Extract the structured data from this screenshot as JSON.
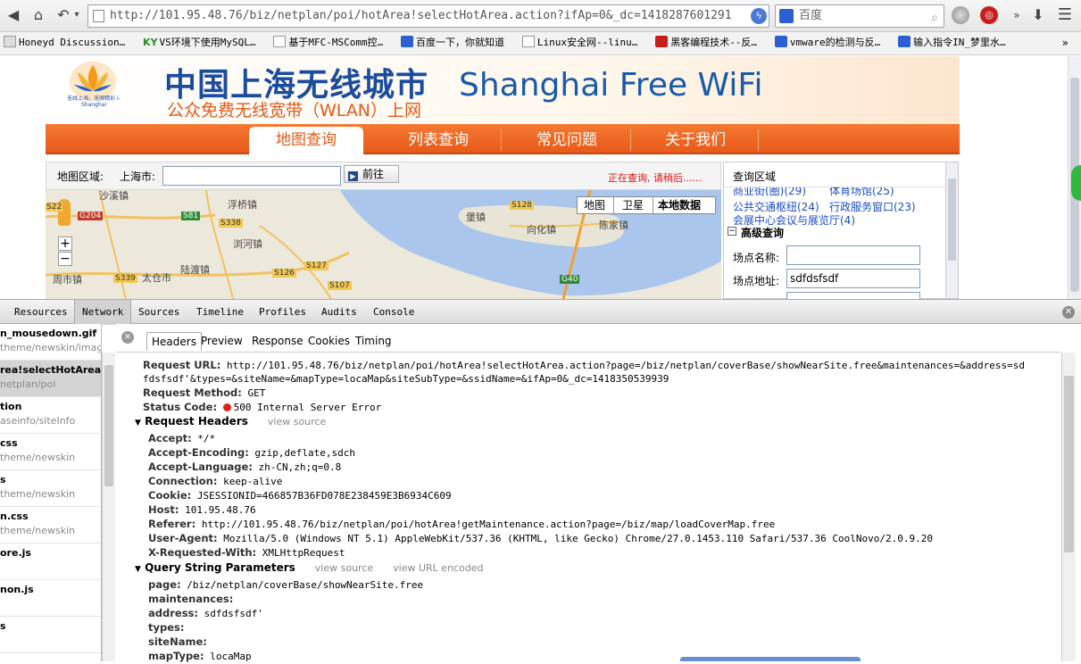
{
  "browser": {
    "url": "http://101.95.48.76/biz/netplan/poi/hotArea!selectHotArea.action?ifAp=0&_dc=1418287601291",
    "search_text": "百度",
    "bookmarks": [
      "Honeyd Discussion…",
      "VS环境下使用MySQL…",
      "基于MFC-MSComm控…",
      "百度一下，你就知道",
      "Linux安全网--linu…",
      "黑客编程技术--反…",
      "vmware的检测与反…",
      "输入指令IN_梦里水…"
    ],
    "bookmark_prefix": "KY"
  },
  "site": {
    "title_cn": "中国上海无线城市",
    "subtitle_cn": "公众免费无线宽带（WLAN）上网",
    "title_en": "Shanghai Free WiFi",
    "logo_text": "无线上海，无限精彩 i-Shanghai",
    "nav": [
      "地图查询",
      "列表查询",
      "常见问题",
      "关于我们"
    ],
    "map_area_label": "地图区域:",
    "city_label": "上海市:",
    "go_button": "前往",
    "status_text": "正在查询, 请稍后......",
    "map_types": [
      "地图",
      "卫星",
      "本地数据"
    ],
    "map_labels": [
      "沙溪镇",
      "浮桥镇",
      "S81",
      "G204",
      "S338",
      "浏河镇",
      "S22",
      "堡镇",
      "S128",
      "向化镇",
      "陈家镇",
      "太仓市",
      "陆渡镇",
      "S127",
      "S126",
      "S339",
      "周市镇",
      "S107",
      "G40"
    ],
    "side_title": "查询区域",
    "side_links": [
      "商业街(圈)(29)",
      "体育场馆(25)",
      "公共交通枢纽(24)",
      "行政服务窗口(23)",
      "会展中心会议与展览厅(4)"
    ],
    "adv_title": "高级查询",
    "field_name_label": "场点名称:",
    "field_addr_label": "场点地址:",
    "field_addr_value": "sdfdsfsdf",
    "zoom_in": "+",
    "zoom_out": "−"
  },
  "devtools": {
    "tabs": [
      "Resources",
      "Network",
      "Sources",
      "Timeline",
      "Profiles",
      "Audits",
      "Console"
    ],
    "files": [
      {
        "name": "n_mousedown.gif",
        "path": "theme/newskin/imag"
      },
      {
        "name": "rea!selectHotArea…",
        "path": "netplan/poi"
      },
      {
        "name": "tion",
        "path": "aseinfo/siteInfo"
      },
      {
        "name": "css",
        "path": "theme/newskin"
      },
      {
        "name": "s",
        "path": "theme/newskin"
      },
      {
        "name": "n.css",
        "path": "theme/newskin"
      },
      {
        "name": "ore.js",
        "path": ""
      },
      {
        "name": "non.js",
        "path": ""
      },
      {
        "name": "s",
        "path": ""
      }
    ],
    "subtabs": [
      "Headers",
      "Preview",
      "Response",
      "Cookies",
      "Timing"
    ],
    "general": [
      {
        "k": "Request URL:",
        "v": "http://101.95.48.76/biz/netplan/poi/hotArea!selectHotArea.action?page=/biz/netplan/coverBase/showNearSite.free&maintenances=&address=sd"
      },
      {
        "k": "",
        "v": "fdsfsdf'&types=&siteName=&mapType=locaMap&siteSubType=&ssidName=&ifAp=0&_dc=1418350539939"
      },
      {
        "k": "Request Method:",
        "v": "GET"
      },
      {
        "k": "Status Code:",
        "v": "500 Internal Server Error"
      }
    ],
    "req_headers_title": "Request Headers",
    "view_source": "view source",
    "view_url_encoded": "view URL encoded",
    "req_headers": [
      {
        "k": "Accept:",
        "v": "*/*"
      },
      {
        "k": "Accept-Encoding:",
        "v": "gzip,deflate,sdch"
      },
      {
        "k": "Accept-Language:",
        "v": "zh-CN,zh;q=0.8"
      },
      {
        "k": "Connection:",
        "v": "keep-alive"
      },
      {
        "k": "Cookie:",
        "v": "JSESSIONID=466857B36FD078E238459E3B6934C609"
      },
      {
        "k": "Host:",
        "v": "101.95.48.76"
      },
      {
        "k": "Referer:",
        "v": "http://101.95.48.76/biz/netplan/poi/hotArea!getMaintenance.action?page=/biz/map/loadCoverMap.free"
      },
      {
        "k": "User-Agent:",
        "v": "Mozilla/5.0 (Windows NT 5.1) AppleWebKit/537.36 (KHTML, like Gecko) Chrome/27.0.1453.110 Safari/537.36 CoolNovo/2.0.9.20"
      },
      {
        "k": "X-Requested-With:",
        "v": "XMLHttpRequest"
      }
    ],
    "qs_title": "Query String Parameters",
    "qs": [
      {
        "k": "page:",
        "v": "/biz/netplan/coverBase/showNearSite.free"
      },
      {
        "k": "maintenances:",
        "v": ""
      },
      {
        "k": "address:",
        "v": "sdfdsfsdf'"
      },
      {
        "k": "types:",
        "v": ""
      },
      {
        "k": "siteName:",
        "v": ""
      },
      {
        "k": "mapType:",
        "v": "locaMap"
      }
    ]
  }
}
